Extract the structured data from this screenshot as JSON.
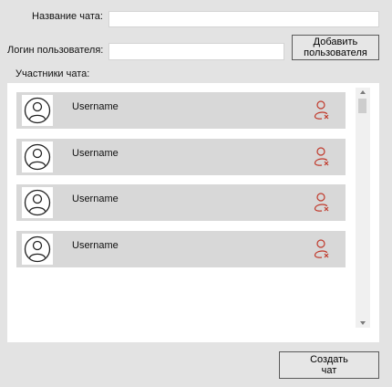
{
  "form": {
    "chat_name_label": "Название чата:",
    "chat_name_value": "",
    "login_label": "Логин пользователя:",
    "login_value": "",
    "add_user_button": "Добавить\nпользователя",
    "participants_label": "Участники чата:",
    "create_button": "Создать\nчат"
  },
  "participants": [
    {
      "name": "Username",
      "avatar_icon": "user-avatar-icon",
      "remove_icon": "remove-user-icon"
    },
    {
      "name": "Username",
      "avatar_icon": "user-avatar-icon",
      "remove_icon": "remove-user-icon"
    },
    {
      "name": "Username",
      "avatar_icon": "user-avatar-icon",
      "remove_icon": "remove-user-icon"
    },
    {
      "name": "Username",
      "avatar_icon": "user-avatar-icon",
      "remove_icon": "remove-user-icon"
    }
  ],
  "colors": {
    "remove_icon": "#c0392b",
    "row_background": "#d8d8d8",
    "window_background": "#e3e3e3"
  }
}
